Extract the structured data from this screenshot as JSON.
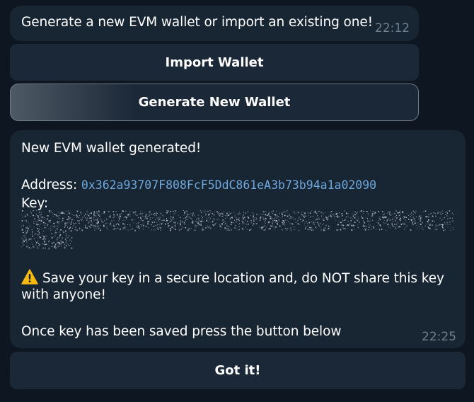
{
  "messages": [
    {
      "text": "Generate a new EVM wallet or import an existing one!",
      "time": "22:12"
    },
    {
      "line1": "New EVM wallet generated!",
      "address_label": "Address: ",
      "address": "0x362a93707F808FcF5DdC861eA3b73b94a1a02090",
      "key_label": "Key:",
      "warning_line1": "Save your key in a secure location and, do NOT share this key",
      "warning_line2": "with anyone!",
      "footer": "Once key has been saved press the button below",
      "time": "22:25"
    }
  ],
  "keyboard1": {
    "import_label": "Import Wallet",
    "generate_label": "Generate New Wallet"
  },
  "keyboard2": {
    "gotit_label": "Got it!"
  },
  "icons": {
    "warning": "warning-icon",
    "spoiler": "hidden-spoiler-text"
  },
  "colors": {
    "background": "#0e1621",
    "bubble": "#182533",
    "button": "#1b2838",
    "link": "#6fa8dc",
    "timestamp": "#6d7f8f"
  }
}
